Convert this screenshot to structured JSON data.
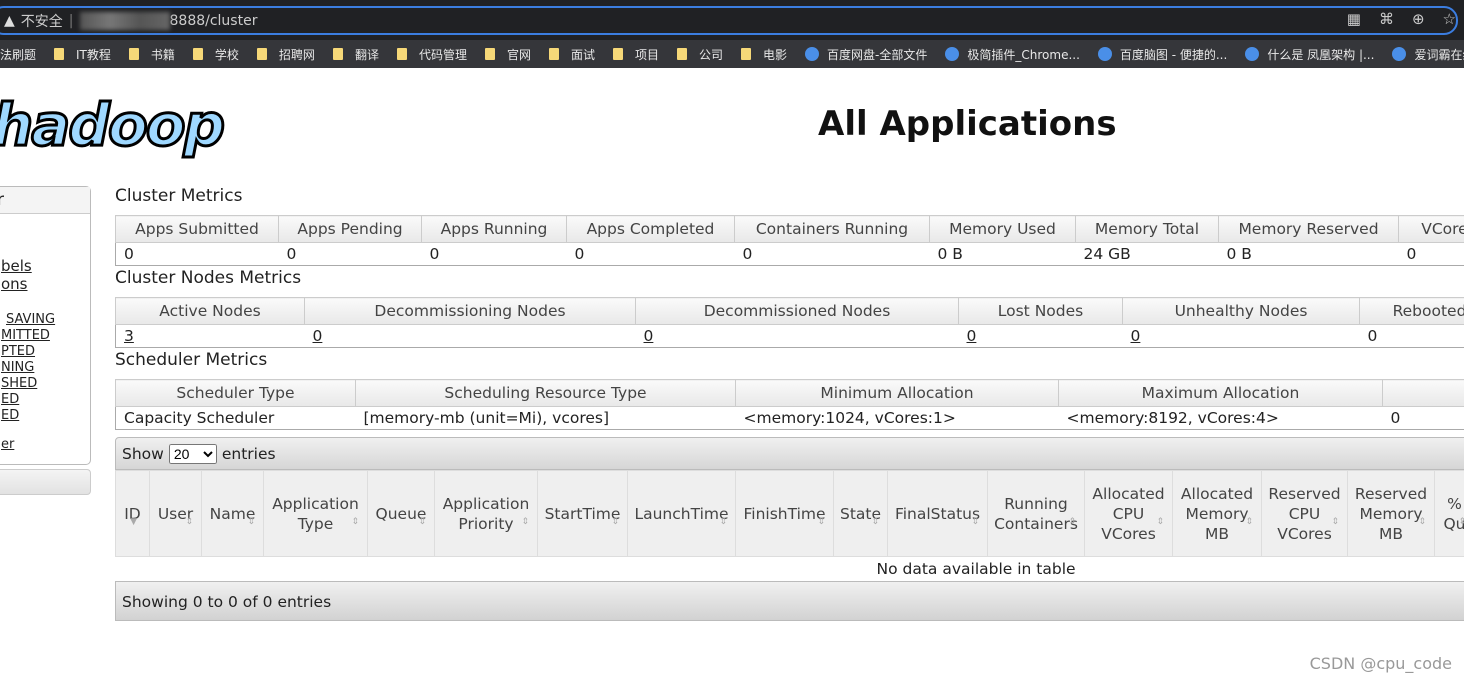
{
  "browser": {
    "security": "不安全",
    "url": "8888/cluster",
    "icons": [
      "qr-icon",
      "translate-icon",
      "zoom-icon",
      "star-icon"
    ],
    "bookmarks": [
      {
        "label": "法刷题",
        "type": "text"
      },
      {
        "label": "IT教程",
        "type": "folder"
      },
      {
        "label": "书籍",
        "type": "folder"
      },
      {
        "label": "学校",
        "type": "folder"
      },
      {
        "label": "招聘网",
        "type": "folder"
      },
      {
        "label": "翻译",
        "type": "folder"
      },
      {
        "label": "代码管理",
        "type": "folder"
      },
      {
        "label": "官网",
        "type": "folder"
      },
      {
        "label": "面试",
        "type": "folder"
      },
      {
        "label": "项目",
        "type": "folder"
      },
      {
        "label": "公司",
        "type": "folder"
      },
      {
        "label": "电影",
        "type": "folder"
      },
      {
        "label": "百度网盘-全部文件",
        "type": "site"
      },
      {
        "label": "极简插件_Chrome...",
        "type": "site"
      },
      {
        "label": "百度脑图 - 便捷的...",
        "type": "site"
      },
      {
        "label": "什么是 凤凰架构 |...",
        "type": "site"
      },
      {
        "label": "爱词霸在线",
        "type": "site"
      }
    ]
  },
  "logo": "hadoop",
  "page_title": "All Applications",
  "sidebar": {
    "header": "r",
    "links": [
      "bels",
      "ons",
      "SAVING",
      "MITTED",
      "PTED",
      "NING",
      "SHED",
      "ED",
      "ED",
      "er"
    ]
  },
  "cluster_metrics": {
    "title": "Cluster Metrics",
    "headers": [
      "Apps Submitted",
      "Apps Pending",
      "Apps Running",
      "Apps Completed",
      "Containers Running",
      "Memory Used",
      "Memory Total",
      "Memory Reserved",
      "VCores"
    ],
    "values": [
      "0",
      "0",
      "0",
      "0",
      "0",
      "0 B",
      "24 GB",
      "0 B",
      "0"
    ]
  },
  "node_metrics": {
    "title": "Cluster Nodes Metrics",
    "headers": [
      "Active Nodes",
      "Decommissioning Nodes",
      "Decommissioned Nodes",
      "Lost Nodes",
      "Unhealthy Nodes",
      "Rebooted"
    ],
    "values": [
      "3",
      "0",
      "0",
      "0",
      "0",
      "0"
    ]
  },
  "scheduler_metrics": {
    "title": "Scheduler Metrics",
    "headers": [
      "Scheduler Type",
      "Scheduling Resource Type",
      "Minimum Allocation",
      "Maximum Allocation",
      ""
    ],
    "values": [
      "Capacity Scheduler",
      "[memory-mb (unit=Mi), vcores]",
      "<memory:1024, vCores:1>",
      "<memory:8192, vCores:4>",
      "0"
    ]
  },
  "apps_table": {
    "show_label": "Show",
    "entries_label": "entries",
    "page_size": "20",
    "headers": [
      "ID",
      "User",
      "Name",
      "Application Type",
      "Queue",
      "Application Priority",
      "StartTime",
      "LaunchTime",
      "FinishTime",
      "State",
      "FinalStatus",
      "Running Containers",
      "Allocated CPU VCores",
      "Allocated Memory MB",
      "Reserved CPU VCores",
      "Reserved Memory MB",
      "% Qu"
    ],
    "empty": "No data available in table",
    "footer": "Showing 0 to 0 of 0 entries"
  },
  "watermark": "CSDN @cpu_code"
}
